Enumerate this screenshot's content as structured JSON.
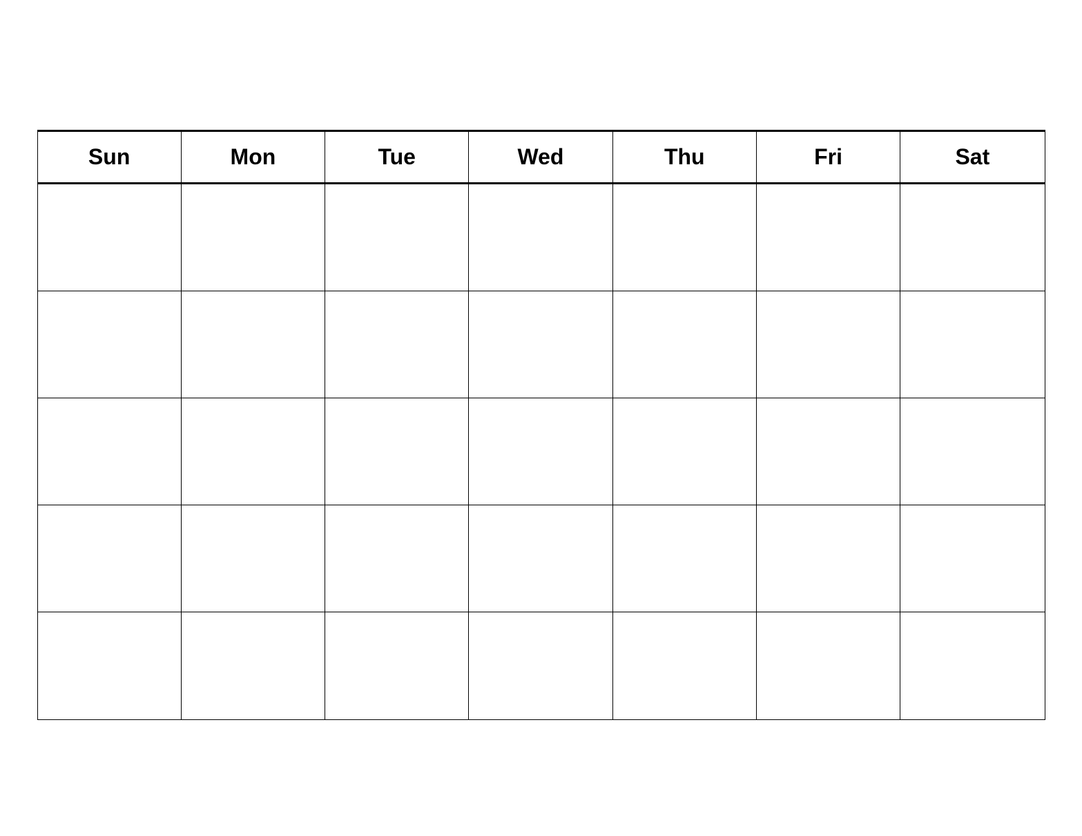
{
  "calendar": {
    "headers": [
      {
        "label": "Sun",
        "id": "sun"
      },
      {
        "label": "Mon",
        "id": "mon"
      },
      {
        "label": "Tue",
        "id": "tue"
      },
      {
        "label": "Wed",
        "id": "wed"
      },
      {
        "label": "Thu",
        "id": "thu"
      },
      {
        "label": "Fri",
        "id": "fri"
      },
      {
        "label": "Sat",
        "id": "sat"
      }
    ],
    "rows": 5,
    "cols": 7
  }
}
